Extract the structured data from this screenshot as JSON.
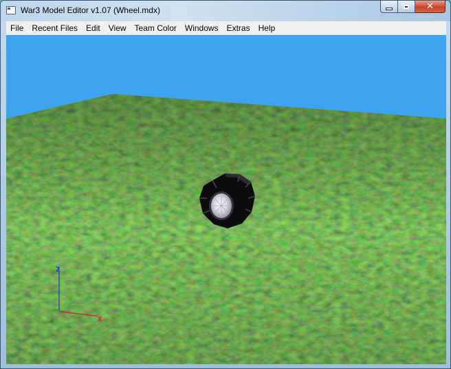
{
  "window": {
    "title": "War3 Model Editor v1.07 (Wheel.mdx)",
    "buttons": {
      "minimize": "minimize",
      "maximize": "maximize",
      "close": "close"
    }
  },
  "menubar": {
    "items": [
      "File",
      "Recent Files",
      "Edit",
      "View",
      "Team Color",
      "Windows",
      "Extras",
      "Help"
    ]
  },
  "viewport": {
    "sky_color": "#3fa4ef",
    "ground_color": "#3a5a1f",
    "model": "wheel",
    "axes": {
      "x": "X",
      "y": "Y",
      "z": "Z"
    },
    "axis_colors": {
      "x": "#e02020",
      "y": "#30e030",
      "z": "#2030e0"
    }
  }
}
